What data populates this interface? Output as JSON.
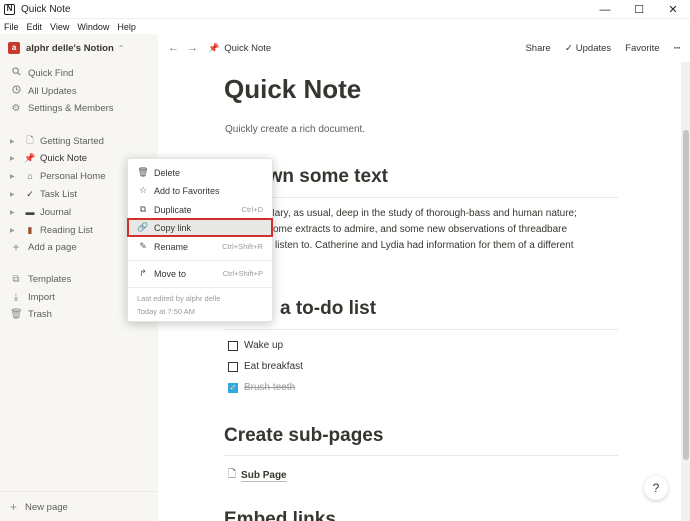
{
  "window": {
    "title": "Quick Note",
    "app_icon": "N"
  },
  "window_controls": {
    "minimize": "—",
    "maximize": "☐",
    "close": "✕"
  },
  "menu": [
    "File",
    "Edit",
    "View",
    "Window",
    "Help"
  ],
  "sidebar": {
    "workspace": {
      "avatar": "a",
      "name": "alphr delle's Notion",
      "chevron": "⌃"
    },
    "actions": [
      {
        "label": "Quick Find",
        "icon": "search-icon"
      },
      {
        "label": "All Updates",
        "icon": "clock-icon"
      },
      {
        "label": "Settings & Members",
        "icon": "gear-icon"
      }
    ],
    "pages": [
      {
        "label": "Getting Started",
        "icon": "page-icon"
      },
      {
        "label": "Quick Note",
        "icon": "pin-icon"
      },
      {
        "label": "Personal Home",
        "icon": "house-icon"
      },
      {
        "label": "Task List",
        "icon": "check-icon"
      },
      {
        "label": "Journal",
        "icon": "book-icon"
      },
      {
        "label": "Reading List",
        "icon": "books-icon"
      }
    ],
    "add_page": "Add a page",
    "footer": [
      {
        "label": "Templates",
        "icon": "shapes-icon"
      },
      {
        "label": "Import",
        "icon": "download-icon"
      },
      {
        "label": "Trash",
        "icon": "trash-icon"
      }
    ],
    "new_page": "New page"
  },
  "topbar": {
    "breadcrumb": "Quick Note",
    "share": "Share",
    "updates": "Updates",
    "favorite": "Favorite",
    "more": "···"
  },
  "page": {
    "title": "Quick Note",
    "subtitle": "Quickly create a rich document.",
    "h_text": "own some text",
    "paragraph": [
      "d Mary, as usual, deep in the study of thorough-bass and human nature;",
      "ome extracts to admire, and some new observations of threadbare",
      "listen to. Catherine and Lydia had information for them of a different"
    ],
    "h_todo": "a to-do list",
    "todos": [
      {
        "label": "Wake up",
        "checked": false
      },
      {
        "label": "Eat breakfast",
        "checked": false
      },
      {
        "label": "Brush teeth",
        "checked": true
      }
    ],
    "h_subpages": "Create sub-pages",
    "subpage": "Sub Page",
    "h_embed": "Embed links",
    "help": "?"
  },
  "context_menu": {
    "items": [
      {
        "label": "Delete",
        "icon": "trash-icon",
        "shortcut": ""
      },
      {
        "label": "Add to Favorites",
        "icon": "star-icon",
        "shortcut": ""
      },
      {
        "label": "Duplicate",
        "icon": "duplicate-icon",
        "shortcut": "Ctrl+D"
      },
      {
        "label": "Copy link",
        "icon": "link-icon",
        "shortcut": ""
      },
      {
        "label": "Rename",
        "icon": "edit-icon",
        "shortcut": "Ctrl+Shift+R"
      },
      {
        "label": "Move to",
        "icon": "arrow-turn-icon",
        "shortcut": "Ctrl+Shift+P"
      }
    ],
    "last_edited": "Last edited by alphr delle",
    "edited_time": "Today at 7:50 AM"
  },
  "colors": {
    "sidebar_bg": "#f7f6f3",
    "highlight_outline": "#d0312d",
    "checkbox": "#2eaadc",
    "pin": "#d33a3a"
  }
}
